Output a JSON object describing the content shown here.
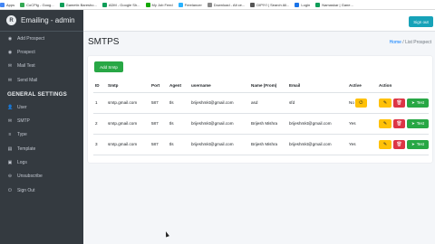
{
  "bookmarks": [
    {
      "label": "Apps",
      "color": "#4285f4"
    },
    {
      "label": "CoCPlg - Goog...",
      "color": "#34a853"
    },
    {
      "label": "Gametix Baresho...",
      "color": "#0f9d58"
    },
    {
      "label": "ADM - Google Sh...",
      "color": "#0f9d58"
    },
    {
      "label": "My Job Feed",
      "color": "#14a800"
    },
    {
      "label": "Freelancer",
      "color": "#29b2fe"
    },
    {
      "label": "Download - Alt ce...",
      "color": "#888888"
    },
    {
      "label": "DIPIYI | Search All...",
      "color": "#555555"
    },
    {
      "label": "Login",
      "color": "#1a73e8"
    },
    {
      "label": "Namaskar | Gane...",
      "color": "#0f9d58"
    }
  ],
  "brand": {
    "logo_letter": "R",
    "title": "Emailing - admin"
  },
  "sidebar": {
    "items_top": [
      {
        "label": "Add Prospect",
        "icon": "◉"
      },
      {
        "label": "Prospect",
        "icon": "◉"
      },
      {
        "label": "Mail Test",
        "icon": "✉"
      },
      {
        "label": "Send Mail",
        "icon": "✉"
      }
    ],
    "section_header": "GENERAL SETTINGS",
    "items_bottom": [
      {
        "label": "User",
        "icon": "👤"
      },
      {
        "label": "SMTP",
        "icon": "✉"
      },
      {
        "label": "Type",
        "icon": "≡"
      },
      {
        "label": "Template",
        "icon": "▤"
      },
      {
        "label": "Logs",
        "icon": "▣"
      },
      {
        "label": "Unsubscribe",
        "icon": "⊖"
      },
      {
        "label": "Sign Out",
        "icon": "⏻"
      }
    ]
  },
  "topbar": {
    "signout_label": "Sign out"
  },
  "page": {
    "title": "SMTPS",
    "breadcrumb_home": "Home",
    "breadcrumb_sep": " / ",
    "breadcrumb_current": "List Prospect"
  },
  "card": {
    "add_label": "Add Smtp"
  },
  "table": {
    "headers": [
      "ID",
      "Smtp",
      "Port",
      "Agent",
      "username",
      "Name (From)",
      "Email",
      "Active",
      "Action"
    ],
    "rows": [
      {
        "id": "1",
        "smtp": "smtp.gmail.com",
        "port": "587",
        "agent": "tls",
        "username": "brijeshmkt@gmail.com",
        "name": "asd",
        "email": "sfd",
        "active": "No"
      },
      {
        "id": "2",
        "smtp": "smtp.gmail.com",
        "port": "587",
        "agent": "tls",
        "username": "brijeshmkt@gmail.com",
        "name": "Brijesh Mishra",
        "email": "brijeshmkt@gmail.com",
        "active": "Yes"
      },
      {
        "id": "3",
        "smtp": "smtp.gmail.com",
        "port": "587",
        "agent": "tls",
        "username": "brijeshmkt@gmail.com",
        "name": "Brijesh Mishra",
        "email": "brijeshmkt@gmail.com",
        "active": "Yes"
      }
    ],
    "test_label": "Test",
    "edit_icon": "✎",
    "delete_icon": "🗑",
    "toggle_icon": "⏻",
    "test_icon": "➤"
  },
  "colors": {
    "sidebar": "#343a40",
    "accent": "#17a2b8",
    "success": "#28a745",
    "warning": "#ffc107",
    "danger": "#dc3545",
    "link": "#007bff"
  }
}
